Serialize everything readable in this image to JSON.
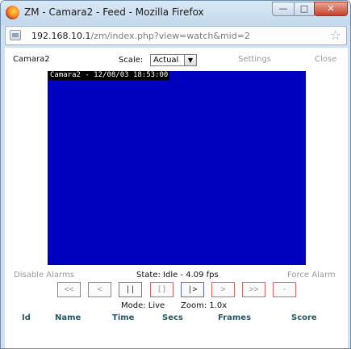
{
  "window": {
    "title": "ZM - Camara2 - Feed - Mozilla Firefox",
    "icon": "firefox-icon",
    "controls": {
      "minimize": "—",
      "maximize": "□",
      "close": "✕"
    }
  },
  "urlbar": {
    "host": "192.168.10.1",
    "path": "/zm/index.php?view=watch&mid=2",
    "bookmark_icon": "star-icon"
  },
  "header": {
    "monitor_name": "Camara2",
    "scale_label": "Scale:",
    "scale_value": "Actual",
    "settings_label": "Settings",
    "close_label": "Close"
  },
  "feed": {
    "timestamp": "Camara2 - 12/08/03 18:53:00",
    "background_color": "#0000bf"
  },
  "status": {
    "disable_alarms": "Disable Alarms",
    "state": "State: Idle - 4.09 fps",
    "force_alarm": "Force Alarm"
  },
  "controls": [
    {
      "name": "fast-rewind",
      "label": "<<",
      "state": "disabled"
    },
    {
      "name": "slow-rewind",
      "label": "<",
      "state": "disabled"
    },
    {
      "name": "pause",
      "label": "||",
      "state": "active"
    },
    {
      "name": "stop",
      "label": "[]",
      "state": "disabled"
    },
    {
      "name": "play",
      "label": "|>",
      "state": "selected"
    },
    {
      "name": "slow-forward",
      "label": ">",
      "state": "disabled"
    },
    {
      "name": "fast-forward",
      "label": ">>",
      "state": "disabled"
    },
    {
      "name": "zoom-out",
      "label": "-",
      "state": "disabled"
    }
  ],
  "mode_info": {
    "mode": "Mode: Live",
    "zoom": "Zoom: 1.0x"
  },
  "events_table": {
    "headers": [
      "Id",
      "Name",
      "Time",
      "Secs",
      "Frames",
      "Score"
    ]
  }
}
